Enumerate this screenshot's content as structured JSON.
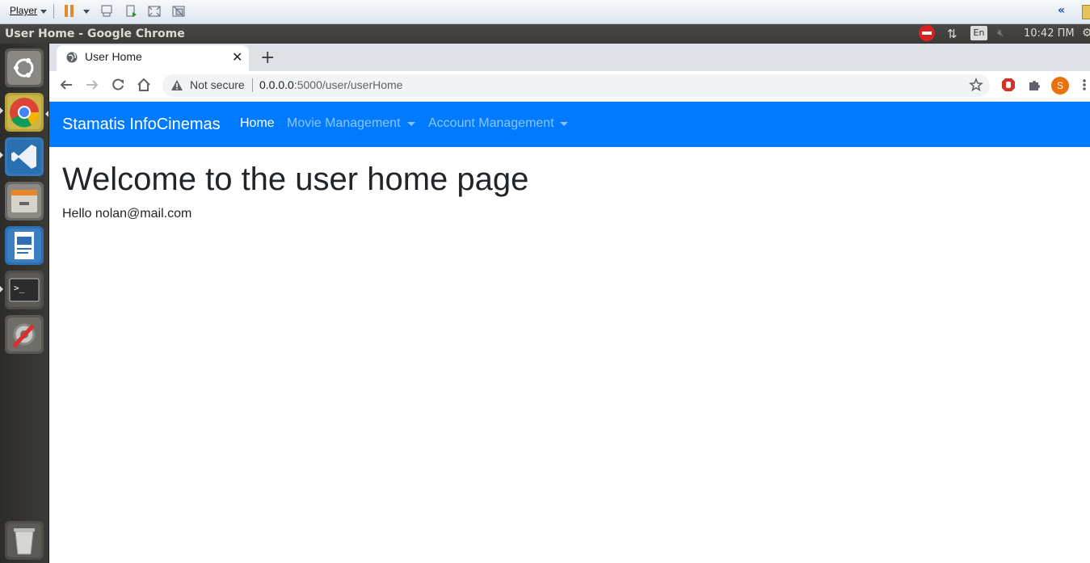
{
  "vm_toolbar": {
    "player_label": "Player"
  },
  "system": {
    "window_title": "User Home - Google Chrome",
    "language": "En",
    "clock": "10:42 ПМ"
  },
  "launcher": {
    "items": [
      "ubuntu-dash",
      "chrome",
      "vscode",
      "file-manager",
      "libreoffice-writer",
      "terminal",
      "system-settings",
      "trash"
    ]
  },
  "browser": {
    "tab_title": "User Home",
    "new_tab": "+",
    "security_label": "Not secure",
    "url_host": "0.0.0.0",
    "url_rest": ":5000/user/userHome",
    "profile_initial": "S"
  },
  "page": {
    "brand": "Stamatis InfoCinemas",
    "nav": {
      "home": "Home",
      "movie": "Movie Management",
      "account": "Account Management"
    },
    "heading": "Welcome to the user home page",
    "greeting": "Hello nolan@mail.com"
  },
  "colors": {
    "navbar": "#007bff",
    "launcher": "#2d2c2a",
    "accent_orange": "#e8710a"
  }
}
